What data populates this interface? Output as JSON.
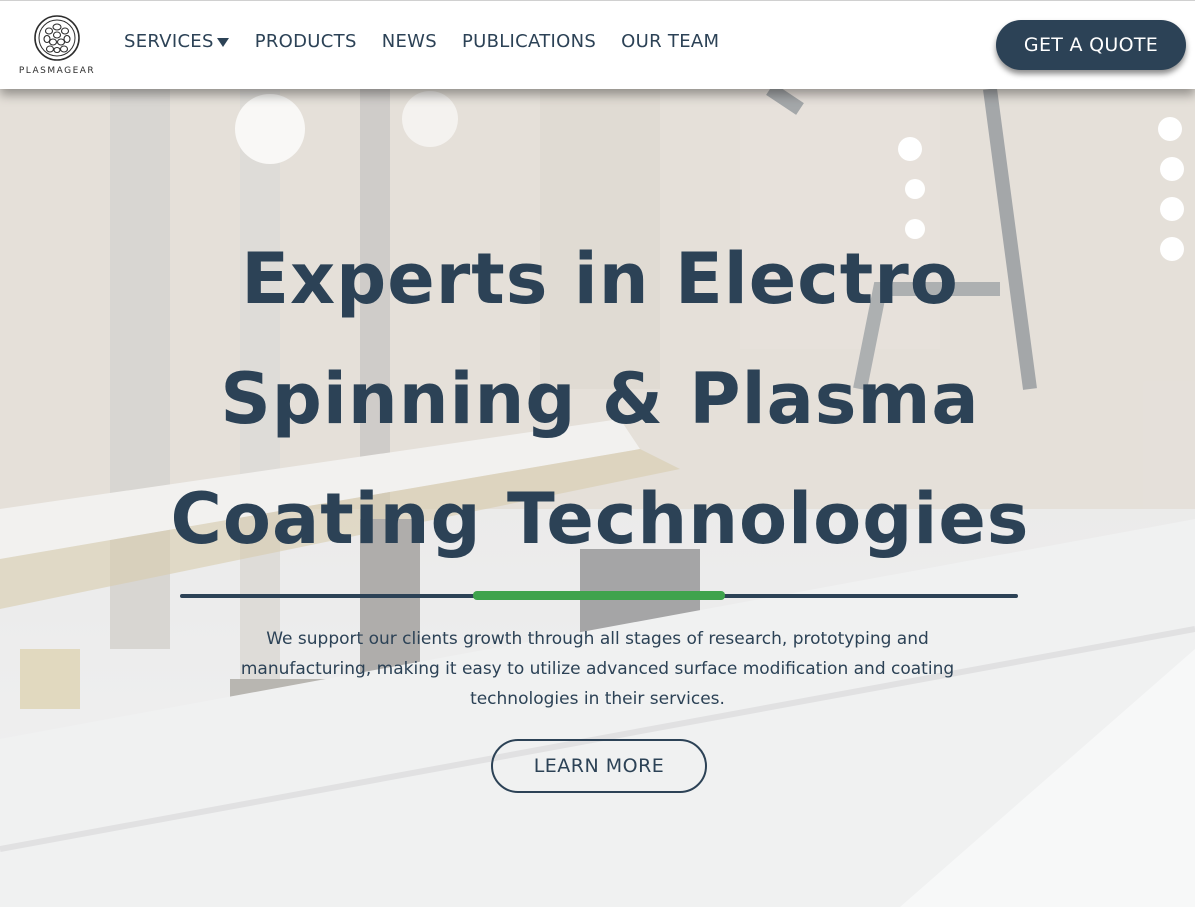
{
  "brand": {
    "name": "PLASMAGEAR"
  },
  "nav": {
    "items": [
      {
        "label": "SERVICES",
        "has_dropdown": true
      },
      {
        "label": "PRODUCTS"
      },
      {
        "label": "NEWS"
      },
      {
        "label": "PUBLICATIONS"
      },
      {
        "label": "OUR TEAM"
      }
    ],
    "cta_label": "GET A QUOTE"
  },
  "hero": {
    "headline_lines": [
      "Experts in Electro",
      "Spinning & Plasma",
      "Coating Technologies"
    ],
    "tagline_lines": [
      "We support our clients growth through all stages of research, prototyping and",
      "manufacturing, making it easy to utilize advanced surface modification and coating",
      "technologies in their services."
    ],
    "button_label": "LEARN MORE"
  },
  "colors": {
    "primary": "#2c4256",
    "accent": "#3fa34d",
    "header_bg": "#ffffff"
  },
  "icons": {
    "logo": "circular-cell-logo-icon",
    "dropdown": "caret-down-icon"
  }
}
